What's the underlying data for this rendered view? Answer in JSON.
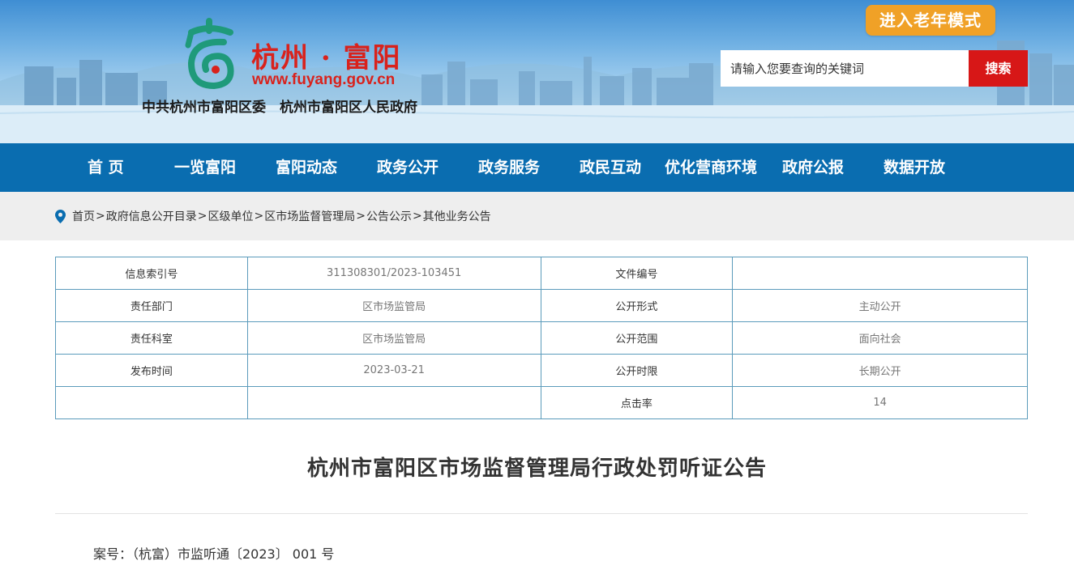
{
  "header": {
    "site_title": "杭州 · 富阳",
    "site_url": "www.fuyang.gov.cn",
    "subtitle": "中共杭州市富阳区委　杭州市富阳区人民政府",
    "elder_mode_label": "进入老年模式",
    "search_placeholder": "请输入您要查询的关键词",
    "search_button": "搜索",
    "logo_icon": "fuyang-logo-icon"
  },
  "nav": {
    "items": [
      "首 页",
      "一览富阳",
      "富阳动态",
      "政务公开",
      "政务服务",
      "政民互动",
      "优化营商环境",
      "政府公报",
      "数据开放"
    ]
  },
  "breadcrumb": {
    "icon": "location-pin-icon",
    "items": [
      "首页",
      "政府信息公开目录",
      "区级单位",
      "区市场监督管理局",
      "公告公示",
      "其他业务公告"
    ]
  },
  "info_table": {
    "rows": [
      [
        "信息索引号",
        "311308301/2023-103451",
        "文件编号",
        ""
      ],
      [
        "责任部门",
        "区市场监管局",
        "公开形式",
        "主动公开"
      ],
      [
        "责任科室",
        "区市场监管局",
        "公开范围",
        "面向社会"
      ],
      [
        "发布时间",
        "2023-03-21",
        "公开时限",
        "长期公开"
      ],
      [
        "",
        "",
        "点击率",
        "14"
      ]
    ]
  },
  "article": {
    "title": "杭州市富阳区市场监督管理局行政处罚听证公告",
    "case_number": "案号：（杭富）市监听通〔2023〕 001 号"
  },
  "colors": {
    "nav_bg": "#0a6db0",
    "brand_red": "#d9221c",
    "elder_btn": "#f0a127",
    "search_btn": "#d71717",
    "table_border": "#5b9bbb"
  }
}
